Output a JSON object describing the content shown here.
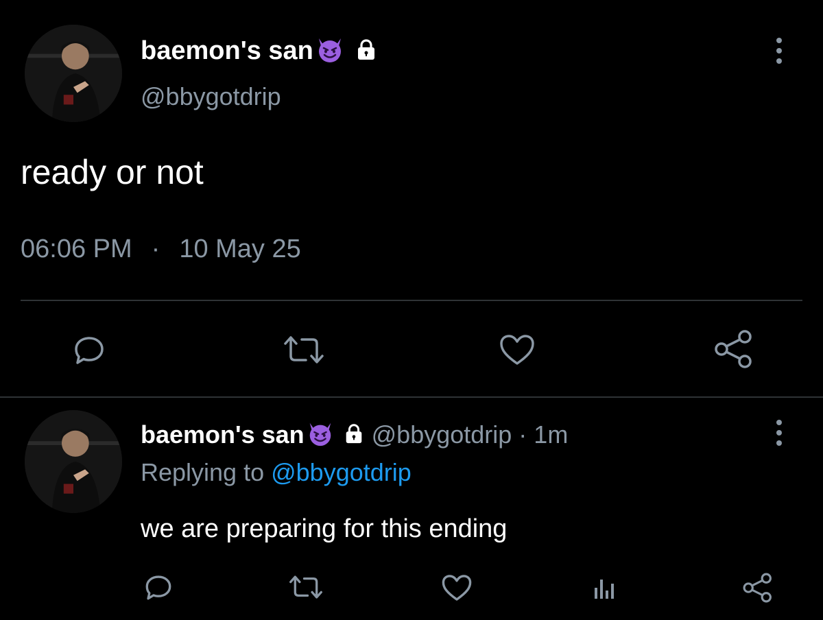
{
  "main_tweet": {
    "display_name": "baemon's san",
    "name_emoji": "smiling-face-with-horns",
    "protected_icon": "lock-icon",
    "handle": "@bbygotdrip",
    "text": "ready or not",
    "time": "06:06 PM",
    "separator": "·",
    "date": "10 May 25",
    "actions": [
      "reply-icon",
      "retweet-icon",
      "like-icon",
      "share-icon"
    ]
  },
  "reply_tweet": {
    "display_name": "baemon's san",
    "name_emoji": "smiling-face-with-horns",
    "protected_icon": "lock-icon",
    "handle_time": "@bbygotdrip · 1m",
    "replying_label": "Replying to ",
    "replying_handle": "@bbygotdrip",
    "text": "we are preparing for this ending",
    "actions": [
      "reply-icon",
      "retweet-icon",
      "like-icon",
      "analytics-icon",
      "share-icon"
    ]
  },
  "colors": {
    "background": "#000000",
    "text": "#ffffff",
    "muted": "#8b98a5",
    "link": "#1d9bf0",
    "divider": "#2f3336",
    "emoji": "#9b5fe0"
  }
}
